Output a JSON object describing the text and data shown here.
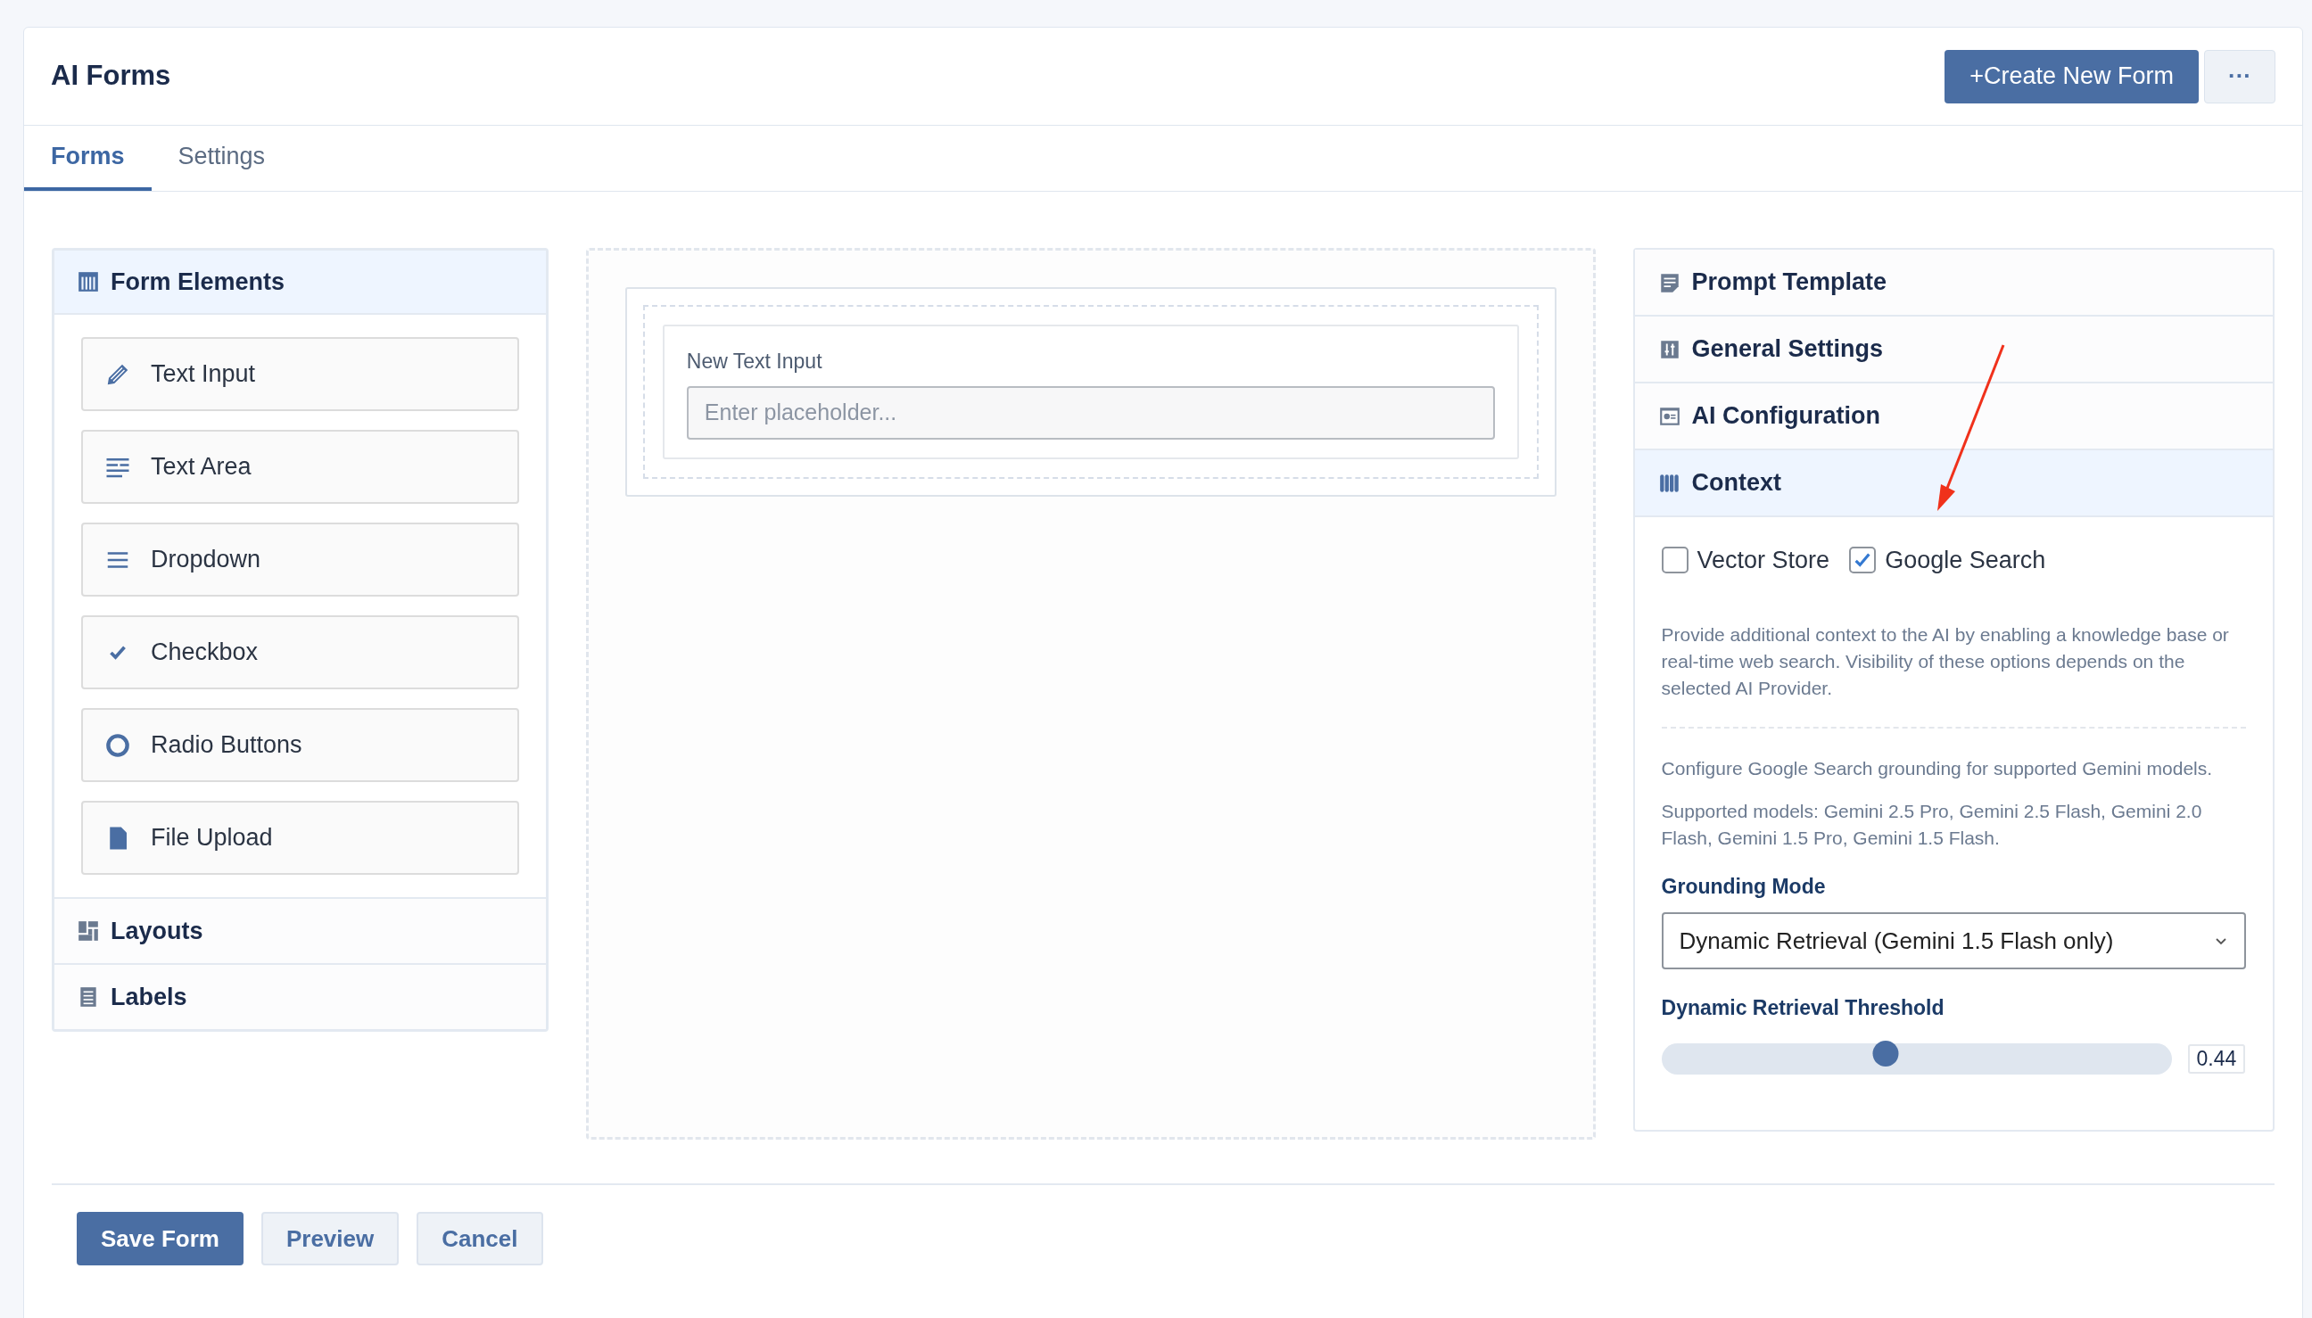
{
  "header": {
    "title": "AI Forms",
    "create_button": "+Create New Form",
    "more_button": "···"
  },
  "tabs": [
    {
      "label": "Forms",
      "selected": true
    },
    {
      "label": "Settings",
      "selected": false
    }
  ],
  "elements_panel": {
    "sections": [
      {
        "title": "Form Elements",
        "expanded": true,
        "items": [
          "Text Input",
          "Text Area",
          "Dropdown",
          "Checkbox",
          "Radio Buttons",
          "File Upload"
        ]
      },
      {
        "title": "Layouts",
        "expanded": false
      },
      {
        "title": "Labels",
        "expanded": false
      }
    ]
  },
  "canvas": {
    "field": {
      "label": "New Text Input",
      "placeholder": "Enter placeholder..."
    }
  },
  "settings_panel": {
    "sections": [
      {
        "title": "Prompt Template",
        "expanded": false
      },
      {
        "title": "General Settings",
        "expanded": false
      },
      {
        "title": "AI Configuration",
        "expanded": false
      },
      {
        "title": "Context",
        "expanded": true
      }
    ],
    "context": {
      "options": [
        {
          "label": "Vector Store",
          "checked": false
        },
        {
          "label": "Google Search",
          "checked": true
        }
      ],
      "description": "Provide additional context to the AI by enabling a knowledge base or real-time web search. Visibility of these options depends on the selected AI Provider.",
      "grounding_note": "Configure Google Search grounding for supported Gemini models.",
      "supported_models": "Supported models: Gemini 2.5 Pro, Gemini 2.5 Flash, Gemini 2.0 Flash, Gemini 1.5 Pro, Gemini 1.5 Flash.",
      "grounding_mode": {
        "label": "Grounding Mode",
        "value": "Dynamic Retrieval (Gemini 1.5 Flash only)"
      },
      "threshold": {
        "label": "Dynamic Retrieval Threshold",
        "level": 0.44,
        "reading": "0.44"
      }
    }
  },
  "footer_buttons": [
    {
      "label": "Save Form",
      "kind": "primary"
    },
    {
      "label": "Preview",
      "kind": "secondary"
    },
    {
      "label": "Cancel",
      "kind": "secondary"
    }
  ]
}
